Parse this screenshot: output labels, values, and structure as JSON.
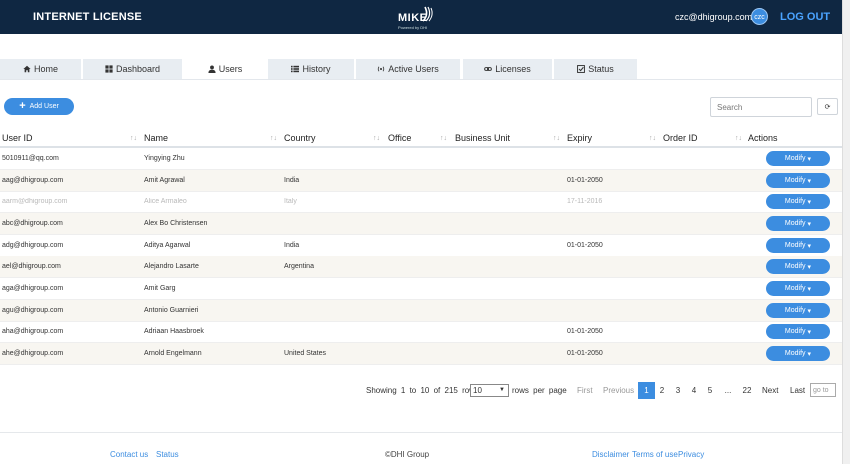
{
  "header": {
    "app_title": "INTERNET LICENSE",
    "logo_text": "MIKE",
    "logo_subtext": "Powered by DHI",
    "user_email": "czc@dhigroup.com",
    "avatar_initials": "czc",
    "logout_label": "LOG OUT"
  },
  "tabs": [
    {
      "label": "Home",
      "icon": "home-icon"
    },
    {
      "label": "Dashboard",
      "icon": "dashboard-icon"
    },
    {
      "label": "Users",
      "icon": "user-icon",
      "active": true
    },
    {
      "label": "History",
      "icon": "list-icon"
    },
    {
      "label": "Active Users",
      "icon": "broadcast-icon"
    },
    {
      "label": "Licenses",
      "icon": "link-icon"
    },
    {
      "label": "Status",
      "icon": "check-square-icon"
    }
  ],
  "toolbar": {
    "add_user_label": "Add User",
    "search_placeholder": "Search",
    "refresh_label": "⟳"
  },
  "table": {
    "columns": [
      "User ID",
      "Name",
      "Country",
      "Office",
      "Business Unit",
      "Expiry",
      "Order ID",
      "Actions"
    ],
    "modify_label": "Modify",
    "rows": [
      {
        "user_id": "5010911@qq.com",
        "name": "Yingying Zhu",
        "country": "",
        "expiry": ""
      },
      {
        "user_id": "aag@dhigroup.com",
        "name": "Amit Agrawal",
        "country": "India",
        "expiry": "01-01-2050"
      },
      {
        "user_id": "aarm@dhigroup.com",
        "name": "Alice Armaleo",
        "country": "Italy",
        "expiry": "17-11-2016",
        "faded": true
      },
      {
        "user_id": "abc@dhigroup.com",
        "name": "Alex Bo Christensen",
        "country": "",
        "expiry": ""
      },
      {
        "user_id": "adg@dhigroup.com",
        "name": "Aditya Agarwal",
        "country": "India",
        "expiry": "01-01-2050"
      },
      {
        "user_id": "ael@dhigroup.com",
        "name": "Alejandro Lasarte",
        "country": "Argentina",
        "expiry": ""
      },
      {
        "user_id": "aga@dhigroup.com",
        "name": "Amit Garg",
        "country": "",
        "expiry": ""
      },
      {
        "user_id": "agu@dhigroup.com",
        "name": "Antonio Guarnieri",
        "country": "",
        "expiry": ""
      },
      {
        "user_id": "aha@dhigroup.com",
        "name": "Adriaan Haasbroek",
        "country": "",
        "expiry": "01-01-2050"
      },
      {
        "user_id": "ahe@dhigroup.com",
        "name": "Arnold Engelmann",
        "country": "United States",
        "expiry": "01-01-2050"
      }
    ]
  },
  "pagination": {
    "info": "Showing 1 to 10 of 215 rows",
    "rows_per_page_value": "10",
    "rows_per_page_label": "rows per page",
    "first": "First",
    "previous": "Previous",
    "pages": [
      "1",
      "2",
      "3",
      "4",
      "5",
      "...",
      "22"
    ],
    "current_page": "1",
    "next": "Next",
    "last": "Last",
    "goto_placeholder": "go to"
  },
  "footer": {
    "contact": "Contact us",
    "status": "Status",
    "copyright": "©DHI Group",
    "disclaimer": "Disclaimer",
    "terms": "Terms of use",
    "privacy": "Privacy"
  },
  "colors": {
    "header_bg": "#0f2742",
    "accent": "#3c8de0",
    "logout": "#4aa3ff",
    "row_alt": "#f8f6f1"
  }
}
